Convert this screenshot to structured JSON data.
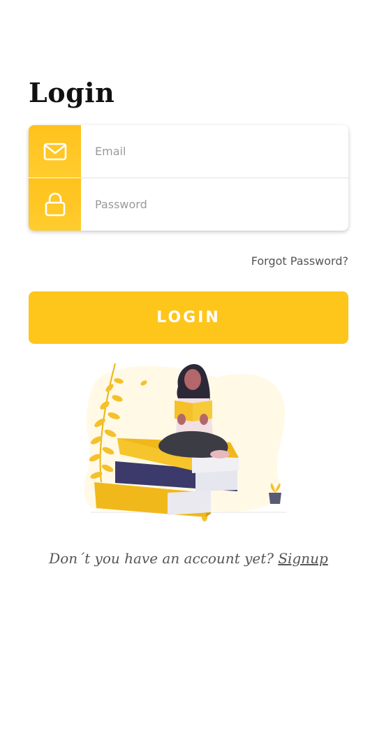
{
  "page": {
    "title": "Login"
  },
  "form": {
    "email_placeholder": "Email",
    "email_value": "",
    "password_placeholder": "Password",
    "password_value": "",
    "email_icon": "mail-icon",
    "password_icon": "lock-icon"
  },
  "forgot_password_label": "Forgot Password?",
  "login_button_label": "LOGIN",
  "illustration": "woman-reading-on-books",
  "signup": {
    "prompt": "Don´t you have an account yet?",
    "link_label": "Signup"
  },
  "colors": {
    "accent": "#fec51b",
    "books_navy": "#3b3a6b",
    "text_dark": "#111111",
    "text_muted": "#555555"
  }
}
